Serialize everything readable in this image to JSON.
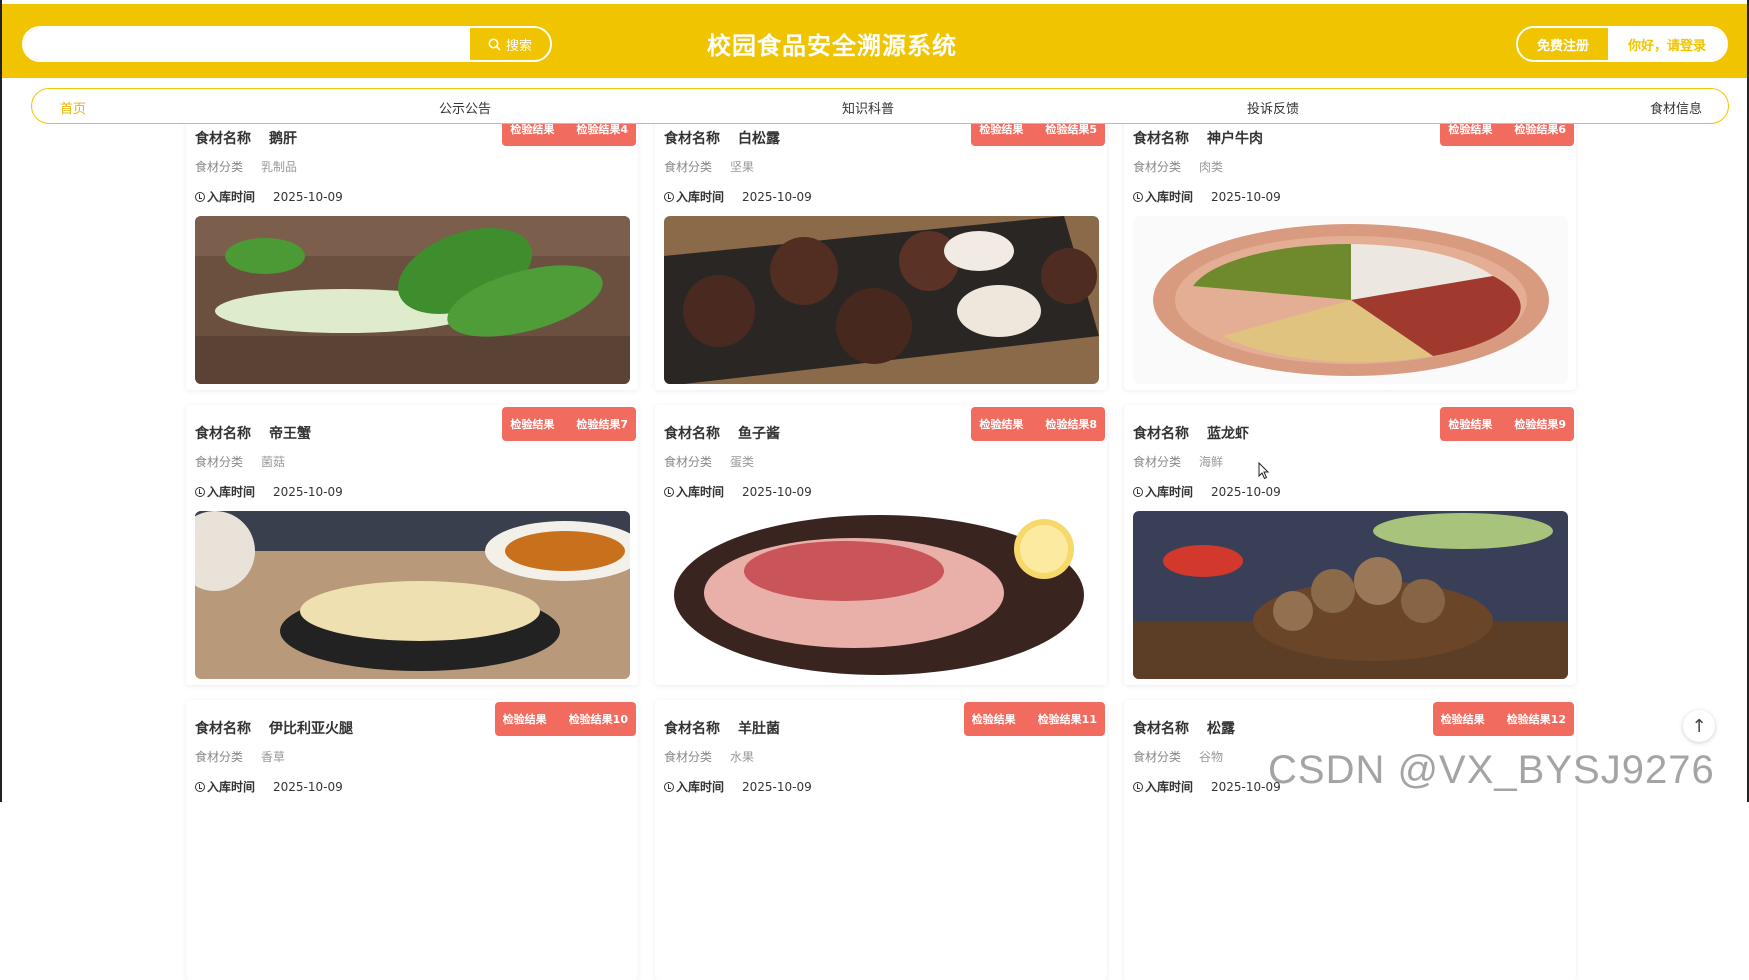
{
  "header": {
    "title": "校园食品安全溯源系统",
    "search_placeholder": "",
    "search_button": "搜索",
    "register": "免费注册",
    "login": "你好，请登录"
  },
  "nav": [
    "首页",
    "公示公告",
    "知识科普",
    "投诉反馈",
    "食材信息"
  ],
  "labels": {
    "name": "食材名称",
    "category": "食材分类",
    "time": "入库时间",
    "inspect": "检验结果"
  },
  "cards": [
    {
      "name": "鹅肝",
      "category": "乳制品",
      "date": "2025-10-09",
      "result": "检验结果4",
      "image_icon": "bok-choy-image"
    },
    {
      "name": "白松露",
      "category": "坚果",
      "date": "2025-10-09",
      "result": "检验结果5",
      "image_icon": "water-chestnut-image"
    },
    {
      "name": "神户牛肉",
      "category": "肉类",
      "date": "2025-10-09",
      "result": "检验结果6",
      "image_icon": "beans-plate-image"
    },
    {
      "name": "帝王蟹",
      "category": "菌菇",
      "date": "2025-10-09",
      "result": "检验结果7",
      "image_icon": "dried-slices-image"
    },
    {
      "name": "鱼子酱",
      "category": "蛋类",
      "date": "2025-10-09",
      "result": "检验结果8",
      "image_icon": "raw-meat-image"
    },
    {
      "name": "蓝龙虾",
      "category": "海鲜",
      "date": "2025-10-09",
      "result": "检验结果9",
      "image_icon": "mushrooms-image"
    },
    {
      "name": "伊比利亚火腿",
      "category": "香草",
      "date": "2025-10-09",
      "result": "检验结果10",
      "image_icon": ""
    },
    {
      "name": "羊肚菌",
      "category": "水果",
      "date": "2025-10-09",
      "result": "检验结果11",
      "image_icon": ""
    },
    {
      "name": "松露",
      "category": "谷物",
      "date": "2025-10-09",
      "result": "检验结果12",
      "image_icon": ""
    }
  ],
  "back_to_top": "↑",
  "watermark": "CSDN @VX_BYSJ9276",
  "colors": {
    "brand": "#f0c400",
    "badge": "#f26b5f"
  }
}
